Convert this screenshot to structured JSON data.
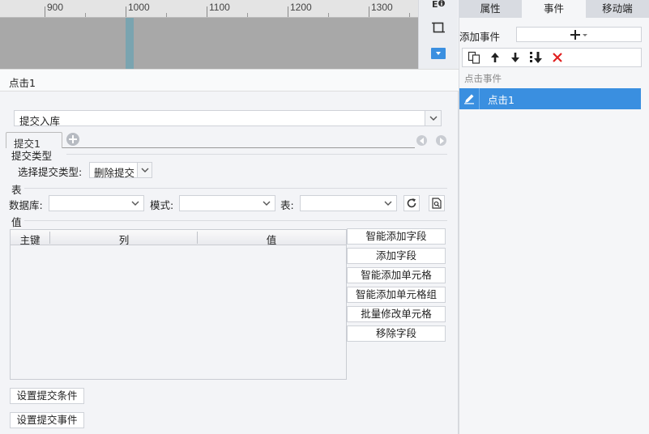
{
  "ruler": {
    "labels": [
      "900",
      "1000",
      "1100",
      "1200",
      "1300"
    ]
  },
  "right_tabs": [
    "属性",
    "事件",
    "移动端"
  ],
  "right_tab_active": "事件",
  "events": {
    "add_label": "添加事件",
    "section_title": "点击事件",
    "items": [
      "点击1"
    ]
  },
  "main": {
    "title": "点击1",
    "action_select": "提交入库",
    "tab_label": "提交1",
    "submit_type": {
      "section": "提交类型",
      "label": "选择提交类型:",
      "value": "删除提交"
    },
    "table_section": {
      "section": "表",
      "db_label": "数据库:",
      "db_value": "",
      "mode_label": "模式:",
      "mode_value": "",
      "table_label": "表:",
      "table_value": ""
    },
    "value_section": {
      "section": "值",
      "columns": [
        "主键",
        "列",
        "值"
      ],
      "rows": []
    },
    "side_buttons": [
      "智能添加字段",
      "添加字段",
      "智能添加单元格",
      "智能添加单元格组",
      "批量修改单元格",
      "移除字段"
    ],
    "bottom_buttons": [
      "设置提交条件",
      "设置提交事件"
    ]
  },
  "colors": {
    "accent": "#3a8fe0",
    "delete_red": "#e02020"
  }
}
